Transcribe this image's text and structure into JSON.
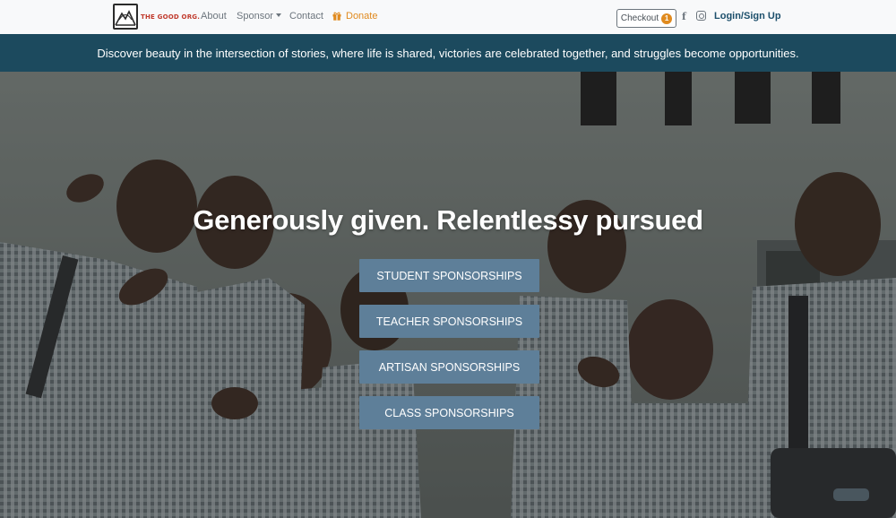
{
  "navbar": {
    "logo_text": "THE GOOD ORG.",
    "links": {
      "about": "About",
      "sponsor": "Sponsor",
      "contact": "Contact",
      "donate": "Donate"
    },
    "checkout_label": "Checkout",
    "cart_count": "1",
    "social_icons": [
      "facebook-icon",
      "instagram-icon"
    ],
    "facebook_glyph": "f",
    "login_label": "Login/Sign Up"
  },
  "tagline": "Discover beauty in the intersection of stories, where life is shared, victories are celebrated together, and struggles become opportunities.",
  "hero": {
    "title": "Generously given. Relentlessy pursued",
    "buttons": [
      "STUDENT SPONSORSHIPS",
      "TEACHER SPONSORSHIPS",
      "ARTISAN SPONSORSHIPS",
      "CLASS SPONSORSHIPS"
    ]
  },
  "colors": {
    "navbar_bg": "#f8f9fa",
    "accent_orange": "#e08a1e",
    "brand_navy": "#1c4a5e",
    "button_blue": "#5e7f99"
  }
}
